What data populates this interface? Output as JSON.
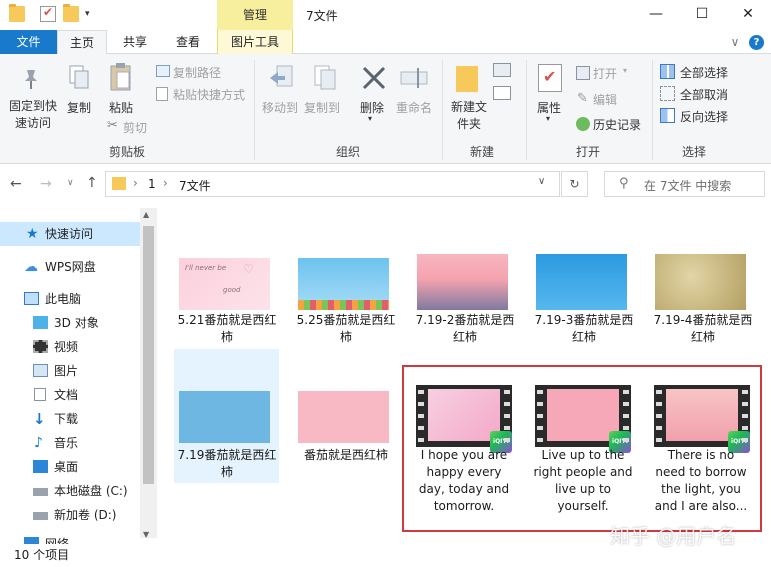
{
  "window": {
    "title": "7文件",
    "manage_label": "管理",
    "minimize": "—",
    "maximize": "☐",
    "close": "✕"
  },
  "tabs": {
    "file": "文件",
    "home": "主页",
    "share": "共享",
    "view": "查看",
    "picture_tools": "图片工具"
  },
  "ribbon": {
    "pin": "固定到快速访问",
    "copy": "复制",
    "paste": "粘贴",
    "copy_path": "复制路径",
    "paste_shortcut": "粘贴快捷方式",
    "cut": "剪切",
    "group_clipboard": "剪贴板",
    "move_to": "移动到",
    "copy_to": "复制到",
    "delete": "删除",
    "rename": "重命名",
    "group_organize": "组织",
    "new_folder": "新建文件夹",
    "group_new": "新建",
    "properties": "属性",
    "open": "打开",
    "edit": "编辑",
    "history": "历史记录",
    "group_open": "打开",
    "select_all": "全部选择",
    "select_none": "全部取消",
    "invert": "反向选择",
    "group_select": "选择"
  },
  "address": {
    "crumb1": "1",
    "crumb2": "7文件",
    "search_placeholder": "在 7文件 中搜索"
  },
  "nav": {
    "quick_access": "快速访问",
    "wps": "WPS网盘",
    "this_pc": "此电脑",
    "objects3d": "3D 对象",
    "videos": "视频",
    "pictures": "图片",
    "documents": "文档",
    "downloads": "下载",
    "music": "音乐",
    "desktop": "桌面",
    "disk_c": "本地磁盘 (C:)",
    "disk_d": "新加卷 (D:)",
    "network": "网络"
  },
  "files": [
    {
      "name": "5.21番茄就是西红柿"
    },
    {
      "name": "5.25番茄就是西红柿"
    },
    {
      "name": "7.19-2番茄就是西红柿"
    },
    {
      "name": "7.19-3番茄就是西红柿"
    },
    {
      "name": "7.19-4番茄就是西红柿"
    },
    {
      "name": "7.19番茄就是西红柿"
    },
    {
      "name": "番茄就是西红柿"
    },
    {
      "name": "I hope you are happy every day, today and tomorrow."
    },
    {
      "name": "Live up to the right people and live up to yourself."
    },
    {
      "name": "There is no need to borrow the light, you and I are also..."
    }
  ],
  "thumbs": {
    "f1_text": "I'll never be",
    "f1_text2": "good",
    "iqiyi": "iQIYI"
  },
  "status": {
    "count": "10 个项目"
  },
  "watermark": "知乎 @用户名"
}
